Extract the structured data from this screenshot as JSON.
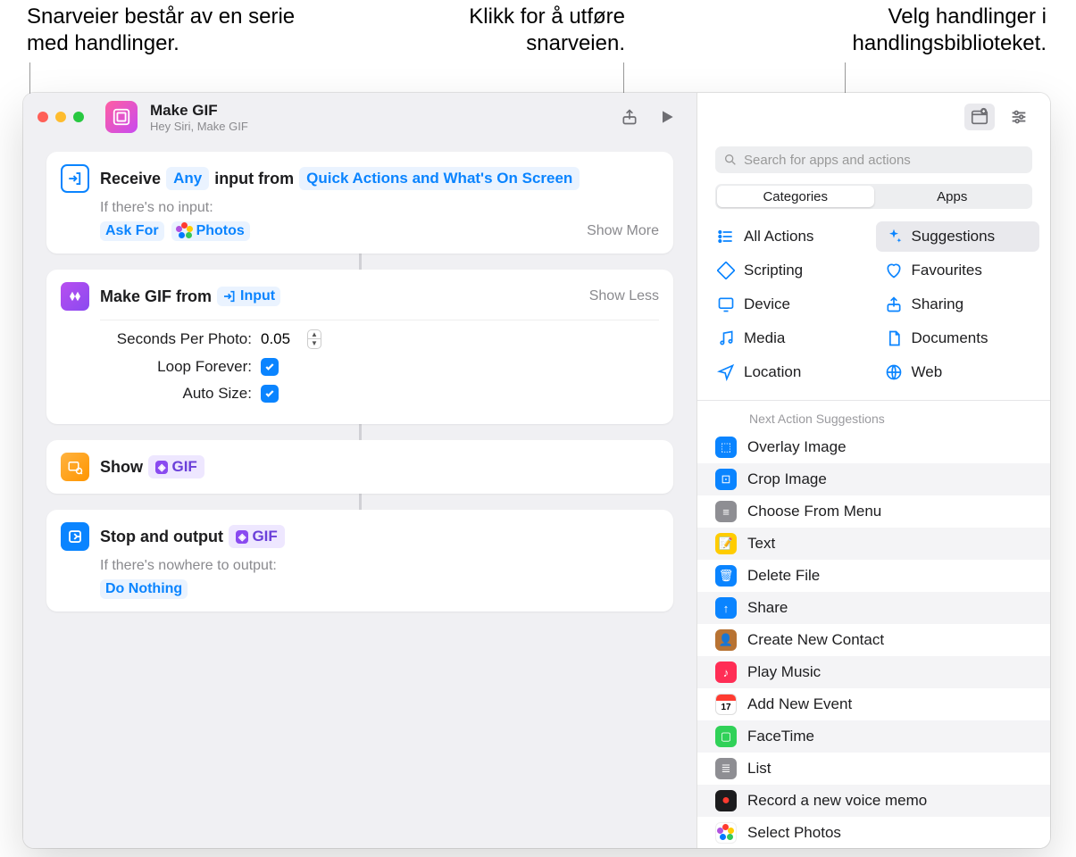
{
  "callouts": {
    "left": "Snarveier består av en serie med handlinger.",
    "center": "Klikk for å utføre snarveien.",
    "right": "Velg handlinger i handlingsbiblioteket."
  },
  "header": {
    "title": "Make GIF",
    "subtitle": "Hey Siri, Make GIF"
  },
  "actions": {
    "receive": {
      "label": "Receive",
      "any": "Any",
      "input_from": "input from",
      "source": "Quick Actions and What's On Screen",
      "no_input_hint": "If there's no input:",
      "ask_for": "Ask For",
      "photos": "Photos",
      "toggle": "Show More"
    },
    "makegif": {
      "label": "Make GIF from",
      "input_chip": "Input",
      "toggle": "Show Less",
      "seconds_label": "Seconds Per Photo:",
      "seconds_value": "0.05",
      "loop_label": "Loop Forever:",
      "auto_label": "Auto Size:"
    },
    "show": {
      "label": "Show",
      "chip": "GIF"
    },
    "stop": {
      "label": "Stop and output",
      "chip": "GIF",
      "hint": "If there's nowhere to output:",
      "do_nothing": "Do Nothing"
    }
  },
  "sidebar": {
    "search_placeholder": "Search for apps and actions",
    "tabs": {
      "categories": "Categories",
      "apps": "Apps"
    },
    "categories": [
      {
        "icon": "list",
        "label": "All Actions"
      },
      {
        "icon": "sparkle",
        "label": "Suggestions",
        "selected": true
      },
      {
        "icon": "scripting",
        "label": "Scripting"
      },
      {
        "icon": "heart",
        "label": "Favourites"
      },
      {
        "icon": "device",
        "label": "Device"
      },
      {
        "icon": "share",
        "label": "Sharing"
      },
      {
        "icon": "music",
        "label": "Media"
      },
      {
        "icon": "doc",
        "label": "Documents"
      },
      {
        "icon": "location",
        "label": "Location"
      },
      {
        "icon": "web",
        "label": "Web"
      }
    ],
    "section_title": "Next Action Suggestions",
    "suggestions": [
      {
        "label": "Overlay Image",
        "color": "#0a84ff",
        "glyph": "layers"
      },
      {
        "label": "Crop Image",
        "color": "#0a84ff",
        "glyph": "crop"
      },
      {
        "label": "Choose From Menu",
        "color": "#8e8e93",
        "glyph": "menu"
      },
      {
        "label": "Text",
        "color": "#ffcc00",
        "glyph": "text"
      },
      {
        "label": "Delete File",
        "color": "#0a84ff",
        "glyph": "trash"
      },
      {
        "label": "Share",
        "color": "#0a84ff",
        "glyph": "share"
      },
      {
        "label": "Create New Contact",
        "color": "#b87333",
        "glyph": "contact"
      },
      {
        "label": "Play Music",
        "color": "#ff2d55",
        "glyph": "music"
      },
      {
        "label": "Add New Event",
        "color": "#ffffff",
        "glyph": "calendar"
      },
      {
        "label": "FaceTime",
        "color": "#30d158",
        "glyph": "video"
      },
      {
        "label": "List",
        "color": "#8e8e93",
        "glyph": "list"
      },
      {
        "label": "Record a new voice memo",
        "color": "#1c1c1e",
        "glyph": "voice"
      },
      {
        "label": "Select Photos",
        "color": "#ffffff",
        "glyph": "photos"
      }
    ]
  }
}
